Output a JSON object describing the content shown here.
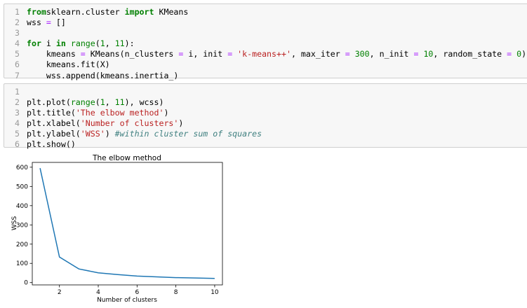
{
  "cells": [
    {
      "lines": [
        {
          "n": "1",
          "tokens": [
            [
              "kw",
              "from"
            ],
            [
              "",
              "sklearn.cluster "
            ],
            [
              "kw",
              "import"
            ],
            [
              "",
              " KMeans"
            ]
          ]
        },
        {
          "n": "2",
          "tokens": [
            [
              "",
              "wss "
            ],
            [
              "op",
              "="
            ],
            [
              "",
              " []"
            ]
          ]
        },
        {
          "n": "3",
          "tokens": []
        },
        {
          "n": "4",
          "tokens": [
            [
              "kw",
              "for"
            ],
            [
              "",
              " i "
            ],
            [
              "kw",
              "in"
            ],
            [
              "",
              " "
            ],
            [
              "bi",
              "range"
            ],
            [
              "",
              "("
            ],
            [
              "num",
              "1"
            ],
            [
              "",
              ", "
            ],
            [
              "num",
              "11"
            ],
            [
              "",
              "):"
            ]
          ]
        },
        {
          "n": "5",
          "tokens": [
            [
              "",
              "    kmeans "
            ],
            [
              "op",
              "="
            ],
            [
              "",
              " KMeans(n_clusters "
            ],
            [
              "op",
              "="
            ],
            [
              "",
              " i, init "
            ],
            [
              "op",
              "="
            ],
            [
              "",
              " "
            ],
            [
              "str",
              "'k-means++'"
            ],
            [
              "",
              ", max_iter "
            ],
            [
              "op",
              "="
            ],
            [
              "",
              " "
            ],
            [
              "num",
              "300"
            ],
            [
              "",
              ", n_init "
            ],
            [
              "op",
              "="
            ],
            [
              "",
              " "
            ],
            [
              "num",
              "10"
            ],
            [
              "",
              ", random_state "
            ],
            [
              "op",
              "="
            ],
            [
              "",
              " "
            ],
            [
              "num",
              "0"
            ],
            [
              "",
              ")"
            ]
          ]
        },
        {
          "n": "6",
          "tokens": [
            [
              "",
              "    kmeans.fit(X)"
            ]
          ]
        },
        {
          "n": "7",
          "tokens": [
            [
              "",
              "    wss.append(kmeans.inertia_)"
            ]
          ]
        }
      ]
    },
    {
      "lines": [
        {
          "n": "1",
          "tokens": []
        },
        {
          "n": "2",
          "tokens": [
            [
              "",
              "plt.plot("
            ],
            [
              "bi",
              "range"
            ],
            [
              "",
              "("
            ],
            [
              "num",
              "1"
            ],
            [
              "",
              ", "
            ],
            [
              "num",
              "11"
            ],
            [
              "",
              "), wcss)"
            ]
          ]
        },
        {
          "n": "3",
          "tokens": [
            [
              "",
              "plt.title("
            ],
            [
              "str",
              "'The elbow method'"
            ],
            [
              "",
              ")"
            ]
          ]
        },
        {
          "n": "4",
          "tokens": [
            [
              "",
              "plt.xlabel("
            ],
            [
              "str",
              "'Number of clusters'"
            ],
            [
              "",
              ")"
            ]
          ]
        },
        {
          "n": "5",
          "tokens": [
            [
              "",
              "plt.ylabel("
            ],
            [
              "str",
              "'WSS'"
            ],
            [
              "",
              ") "
            ],
            [
              "cm",
              "#within cluster sum of squares"
            ]
          ]
        },
        {
          "n": "6",
          "tokens": [
            [
              "",
              "plt.show()"
            ]
          ]
        }
      ]
    }
  ],
  "chart_data": {
    "type": "line",
    "title": "The elbow method",
    "xlabel": "Number of clusters",
    "ylabel": "WSS",
    "xlim": [
      0.6,
      10.4
    ],
    "ylim": [
      -12,
      625
    ],
    "x_ticks": [
      2,
      4,
      6,
      8,
      10
    ],
    "y_ticks": [
      0,
      100,
      200,
      300,
      400,
      500,
      600
    ],
    "line_color": "#1f77b4",
    "grid": false,
    "x": [
      1,
      2,
      3,
      4,
      5,
      6,
      7,
      8,
      9,
      10
    ],
    "series": [
      {
        "values": [
          595,
          133,
          71,
          51,
          42,
          34,
          30,
          26,
          24,
          22
        ]
      }
    ]
  }
}
